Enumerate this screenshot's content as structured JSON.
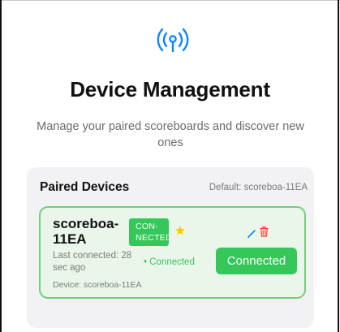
{
  "header": {
    "icon": "antenna-signal-icon",
    "title": "Device Management",
    "subtitle": "Manage your paired scoreboards and discover new ones"
  },
  "paired_devices": {
    "title": "Paired Devices",
    "default_label": "Default: scoreboa-11EA",
    "devices": [
      {
        "name": "scoreboa-11EA",
        "badge": "CON-\nNECTED",
        "is_default": true,
        "last_connected": "Last connected: 28 sec ago",
        "status": "• Connected",
        "action_label": "Connected",
        "device_label": "Device: scoreboa-11EA",
        "icons": [
          "star-icon",
          "edit-icon",
          "trash-icon"
        ]
      }
    ]
  },
  "colors": {
    "accent_blue": "#0a84ff",
    "connected_green": "#35c759",
    "card_border_green": "#6fd07a",
    "star_yellow": "#ffcc00",
    "delete_red": "#ff3b30"
  }
}
